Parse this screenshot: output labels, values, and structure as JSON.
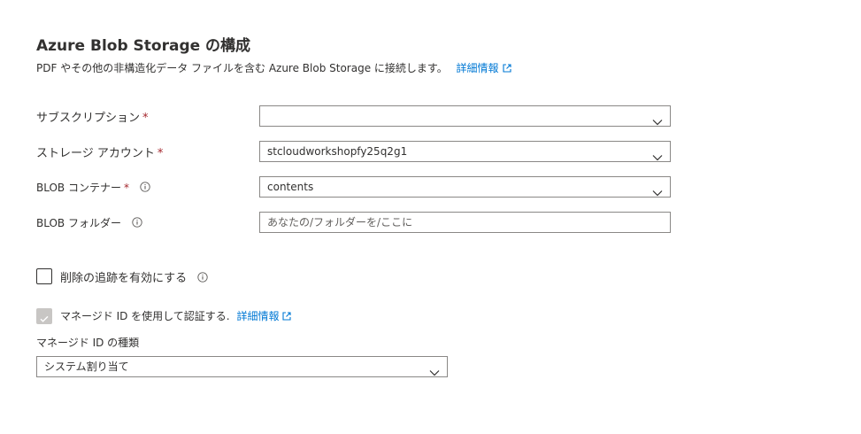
{
  "header": {
    "title": "Azure Blob Storage の構成",
    "description": "PDF やその他の非構造化データ ファイルを含む Azure Blob Storage に接続します。",
    "learn_more": "詳細情報"
  },
  "form": {
    "subscription": {
      "label": "サブスクリプション",
      "required": "*",
      "value": ""
    },
    "storage_account": {
      "label": "ストレージ アカウント",
      "required": "*",
      "value": "stcloudworkshopfy25q2g1"
    },
    "blob_container": {
      "label": "BLOB コンテナー",
      "required": "*",
      "value": "contents"
    },
    "blob_folder": {
      "label": "BLOB フォルダー",
      "placeholder": "あなたの/フォルダーを/ここに",
      "value": ""
    }
  },
  "deletion_tracking": {
    "label": "削除の追跡を有効にする",
    "checked": false
  },
  "managed_identity": {
    "checkbox_label": "マネージド ID を使用して認証する.",
    "learn_more": "詳細情報",
    "checked": true,
    "disabled": true,
    "type_label": "マネージド ID の種類",
    "type_value": "システム割り当て"
  },
  "colors": {
    "link": "#0078d4",
    "required": "#a4262c",
    "border": "#8a8886",
    "disabled_check": "#c8c6c4"
  },
  "icons": [
    "external-link-icon",
    "info-icon",
    "chevron-down-icon",
    "checkmark-icon"
  ]
}
